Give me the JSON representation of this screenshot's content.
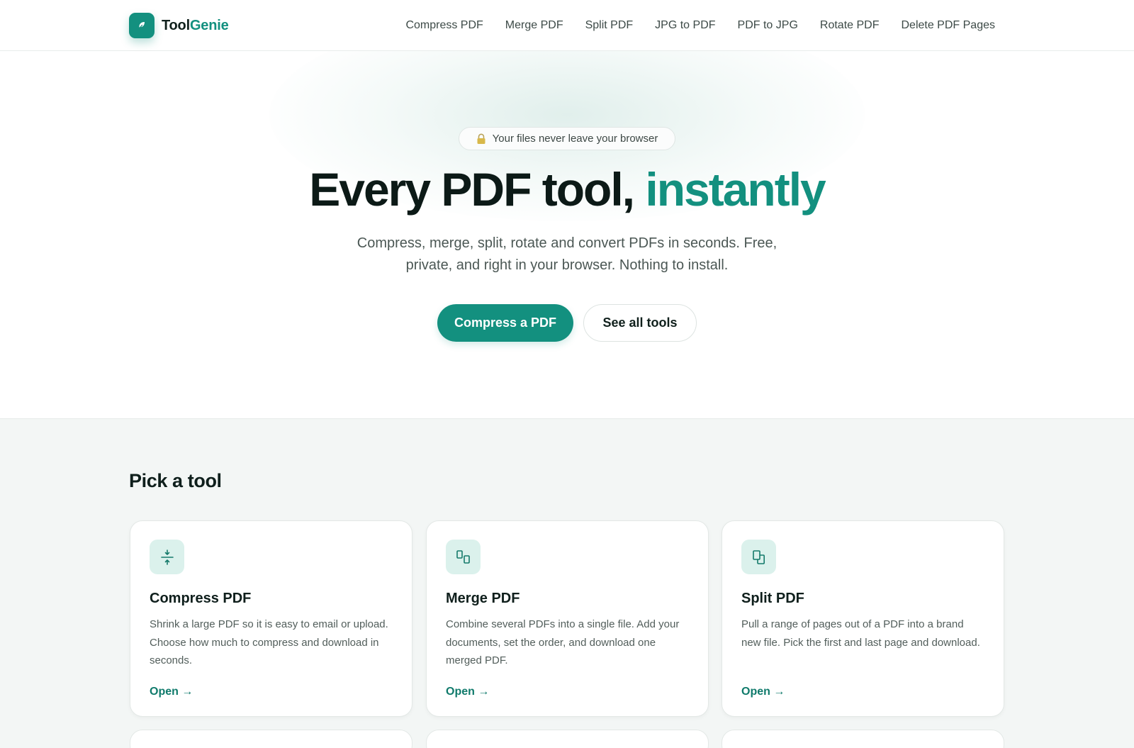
{
  "brand": {
    "name_part1": "Tool",
    "name_part2": "Genie",
    "accent_color": "#13907f",
    "logo_icon": "leaf-icon"
  },
  "nav": {
    "items": [
      {
        "label": "Compress PDF"
      },
      {
        "label": "Merge PDF"
      },
      {
        "label": "Split PDF"
      },
      {
        "label": "JPG to PDF"
      },
      {
        "label": "PDF to JPG"
      },
      {
        "label": "Rotate PDF"
      },
      {
        "label": "Delete PDF Pages"
      }
    ]
  },
  "hero": {
    "badge_icon": "lock-icon",
    "badge_text": "Your files never leave your browser",
    "title_main": "Every PDF tool, ",
    "title_accent": "instantly",
    "subtitle": "Compress, merge, split, rotate and convert PDFs in seconds. Free, private, and right in your browser. Nothing to install.",
    "primary_cta": "Compress a PDF",
    "secondary_cta": "See all tools"
  },
  "tools": {
    "heading": "Pick a tool",
    "cards": [
      {
        "icon": "compress-icon",
        "title": "Compress PDF",
        "description": "Shrink a large PDF so it is easy to email or upload. Choose how much to compress and download in seconds.",
        "link": "Open →"
      },
      {
        "icon": "merge-icon",
        "title": "Merge PDF",
        "description": "Combine several PDFs into a single file. Add your documents, set the order, and download one merged PDF.",
        "link": "Open →"
      },
      {
        "icon": "split-icon",
        "title": "Split PDF",
        "description": "Pull a range of pages out of a PDF into a brand new file. Pick the first and last page and download.",
        "link": "Open →"
      }
    ]
  }
}
